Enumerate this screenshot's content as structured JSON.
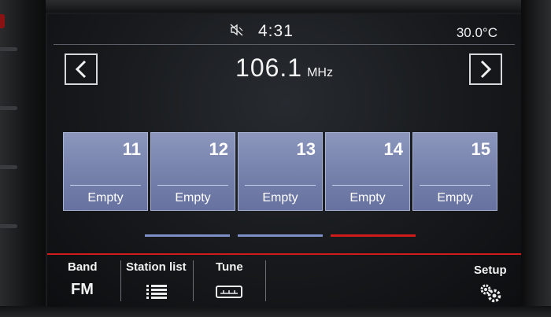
{
  "status": {
    "time": "4:31",
    "temperature": "30.0°C",
    "mute_icon": "speaker-muted-icon"
  },
  "tuner": {
    "frequency": "106.1",
    "unit": "MHz",
    "prev_icon": "chevron-left-icon",
    "next_icon": "chevron-right-icon"
  },
  "presets": [
    {
      "number": "11",
      "label": "Empty"
    },
    {
      "number": "12",
      "label": "Empty"
    },
    {
      "number": "13",
      "label": "Empty"
    },
    {
      "number": "14",
      "label": "Empty"
    },
    {
      "number": "15",
      "label": "Empty"
    }
  ],
  "page_indicator": {
    "pages": 3,
    "active_page": 3,
    "active_color": "#d01b1b",
    "inactive_color": "#7f8fc8"
  },
  "bottom_bar": {
    "band_label": "Band",
    "band_value": "FM",
    "station_list_label": "Station list",
    "station_list_icon": "list-icon",
    "tune_label": "Tune",
    "tune_icon": "tuner-scale-icon",
    "setup_label": "Setup",
    "setup_icon": "gear-icon"
  },
  "colors": {
    "accent": "#d01b1b",
    "preset_tile": "#7a85b0"
  }
}
